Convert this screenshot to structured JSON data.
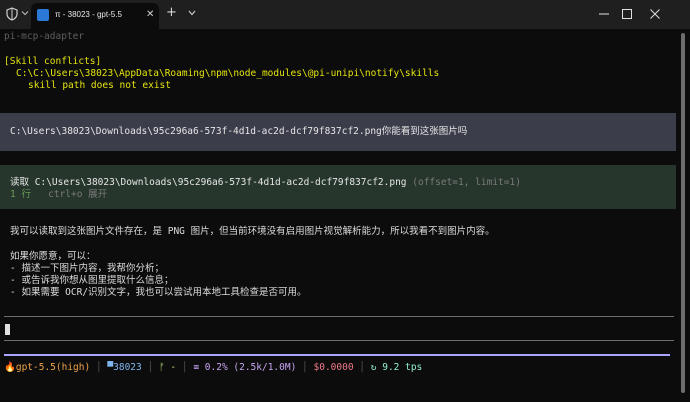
{
  "window": {
    "tab_title": "π - 38023 - gpt-5.5",
    "tab_close": "✕",
    "new_tab": "+",
    "colors": {
      "titlebar": "#1f1f1f",
      "terminal_bg": "#0c0c0c"
    }
  },
  "terminal": {
    "header": "pi-mcp-adapter",
    "skill_conflicts": {
      "title": "[Skill conflicts]",
      "path": "C:\\C:\\Users\\38023\\AppData\\Roaming\\npm\\node_modules\\@pi-unipi\\notify\\skills",
      "message": "skill path does not exist"
    },
    "user_message": "C:\\Users\\38023\\Downloads\\95c296a6-573f-4d1d-ac2d-dcf79f837cf2.png你能看到这张图片吗",
    "tool_call": {
      "verb": "读取",
      "path": "C:\\Users\\38023\\Downloads\\95c296a6-573f-4d1d-ac2d-dcf79f837cf2.png",
      "args": "(offset=1, limit=1)",
      "lines": "1 行",
      "hint": "ctrl+o 展开"
    },
    "assistant": {
      "line1": "我可以读取到这张图片文件存在，是 PNG 图片，但当前环境没有启用图片视觉解析能力，所以我看不到图片内容。",
      "line2": "如果你愿意，可以：",
      "bullet1": "- 描述一下图片内容，我帮你分析；",
      "bullet2": "- 或告诉我你想从图里提取什么信息；",
      "bullet3": "- 如果需要 OCR/识别文字，我也可以尝试用本地工具检查是否可用。"
    }
  },
  "statusbar": {
    "model": "gpt-5.5(high)",
    "folder": "38023",
    "branch": "-",
    "context": "0.2% (2.5k/1.0M)",
    "cost": "$0.0000",
    "speed": "9.2 tps",
    "colors": {
      "model": "#f0a34a",
      "folder": "#7fb6f0",
      "branch": "#b8e07a",
      "context": "#c7a6f5",
      "cost": "#f07a8a",
      "speed": "#8ff0d6"
    }
  }
}
